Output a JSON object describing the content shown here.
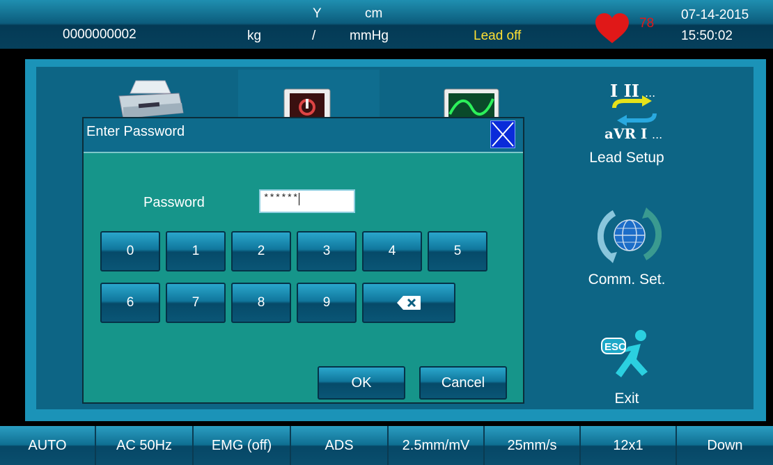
{
  "header": {
    "patient_id": "0000000002",
    "weight_unit": "kg",
    "height_label": "Y",
    "height_unit": "cm",
    "slash": "/",
    "bp_unit": "mmHg",
    "lead_status": "Lead off",
    "heart_rate": "78",
    "date": "07-14-2015",
    "time": "15:50:02",
    "heart_color": "#e01818",
    "lead_status_color": "#ffe033"
  },
  "menu": {
    "items": [
      {
        "icon": "printer-icon",
        "label": ""
      },
      {
        "icon": "monitor-icon",
        "label": ""
      },
      {
        "icon": "ecg-waveform-icon",
        "label": ""
      }
    ],
    "side": [
      {
        "icon": "lead-setup-icon",
        "label": "Lead Setup"
      },
      {
        "icon": "globe-sync-icon",
        "label": "Comm. Set."
      },
      {
        "icon": "esc-exit-icon",
        "label": "Exit"
      }
    ]
  },
  "dialog": {
    "title": "Enter Password",
    "password_label": "Password",
    "password_value": "******",
    "keys": [
      "0",
      "1",
      "2",
      "3",
      "4",
      "5",
      "6",
      "7",
      "8",
      "9"
    ],
    "ok_label": "OK",
    "cancel_label": "Cancel"
  },
  "footer": {
    "items": [
      "AUTO",
      "AC 50Hz",
      "EMG (off)",
      "ADS",
      "2.5mm/mV",
      "25mm/s",
      "12x1",
      "Down"
    ]
  }
}
